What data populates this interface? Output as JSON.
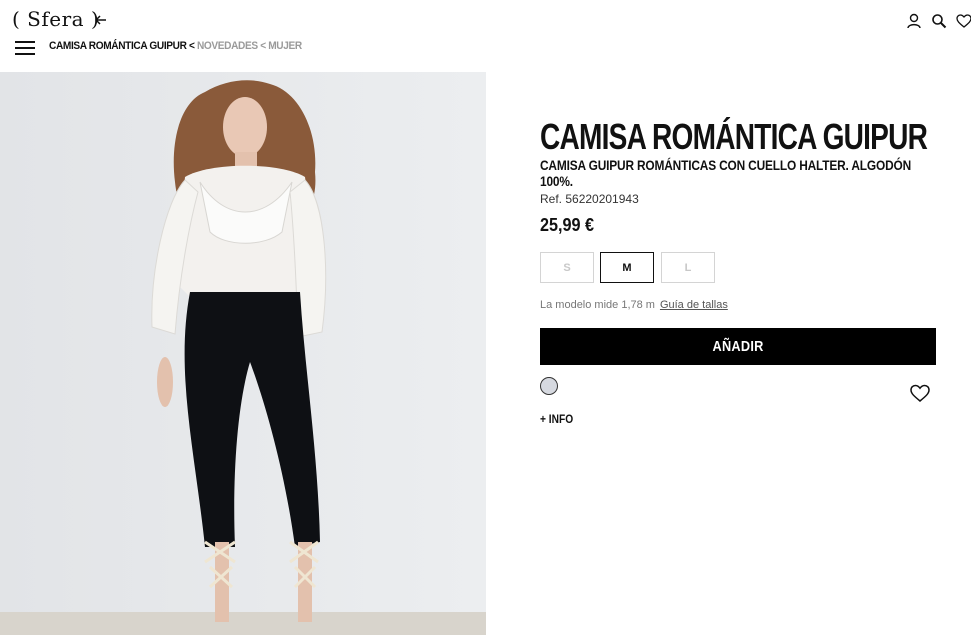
{
  "header": {
    "logo_text": "( Sfera )",
    "breadcrumb": {
      "current": "CAMISA ROMÁNTICA GUIPUR",
      "separator1": " < ",
      "link1": "NOVEDADES",
      "separator2": " < ",
      "link2": "MUJER"
    },
    "icons": [
      "back-arrow-icon",
      "menu-icon",
      "user-icon",
      "search-icon",
      "heart-icon"
    ]
  },
  "product": {
    "title": "CAMISA ROMÁNTICA GUIPUR",
    "subtitle": "CAMISA GUIPUR ROMÁNTICAS CON CUELLO HALTER. ALGODÓN 100%.",
    "ref": "Ref. 56220201943",
    "price": "25,99 €",
    "sizes": [
      {
        "label": "S",
        "selected": false
      },
      {
        "label": "M",
        "selected": true
      },
      {
        "label": "L",
        "selected": false
      }
    ],
    "model_text": "La modelo mide 1,78 m",
    "size_guide": "Guía de tallas",
    "add_button": "AÑADIR",
    "color_swatch": "#d6d9e0",
    "more_info": "+ INFO"
  },
  "colors": {
    "accent": "#000000",
    "muted_link": "#9a9a9a",
    "photo_bg": "#e6e8ea"
  }
}
